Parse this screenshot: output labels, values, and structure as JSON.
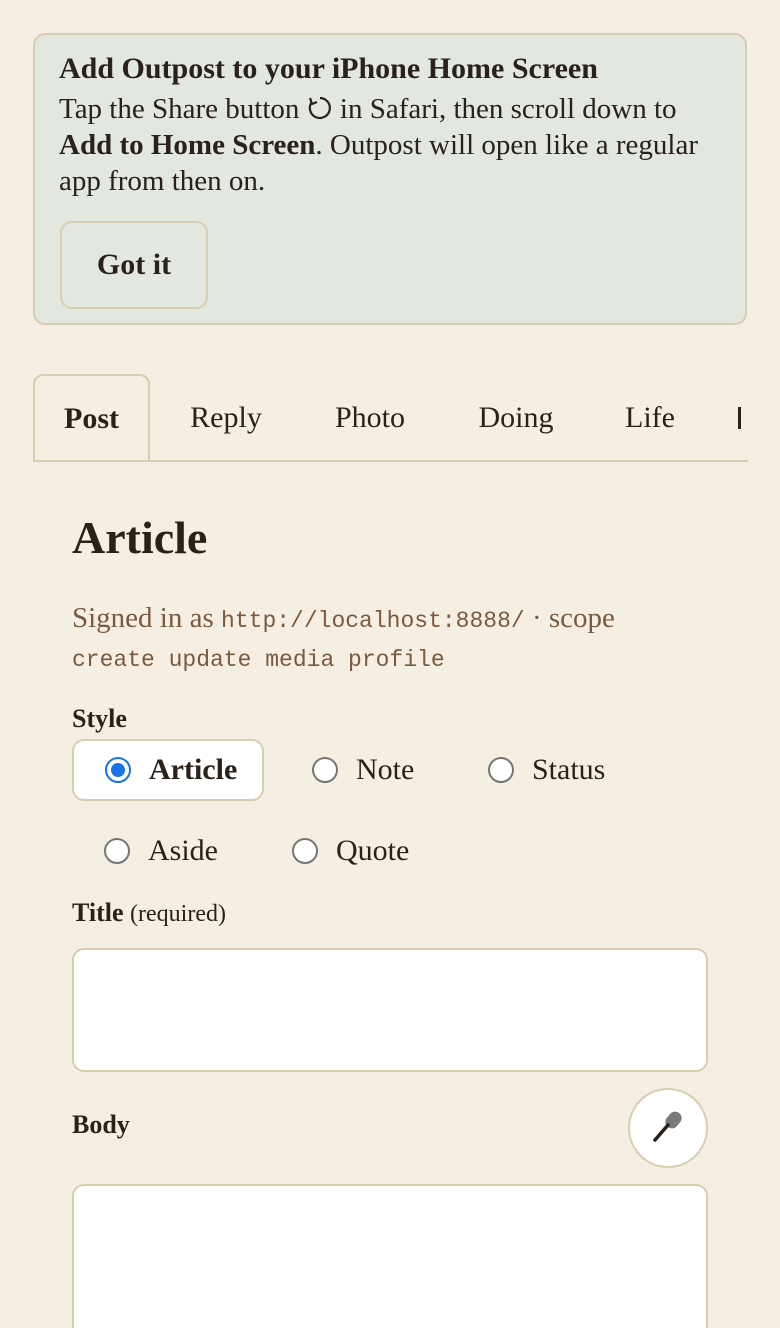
{
  "banner": {
    "title": "Add Outpost to your iPhone Home Screen",
    "text_before": "Tap the Share button ",
    "text_middle": " in Safari, then scroll down to ",
    "text_bold": "Add to Home Screen",
    "text_after": ". Outpost will open like a regular app from then on.",
    "dismiss_label": "Got it"
  },
  "tabs": [
    {
      "label": "Post",
      "active": true
    },
    {
      "label": "Reply"
    },
    {
      "label": "Photo"
    },
    {
      "label": "Doing"
    },
    {
      "label": "Life"
    }
  ],
  "form": {
    "heading": "Article",
    "signed_prefix": "Signed in as ",
    "signed_url": "http://localhost:8888/",
    "signed_scope_label": " · scope ",
    "signed_scopes": "create update media profile",
    "style_label": "Style",
    "styles": [
      {
        "label": "Article",
        "selected": true
      },
      {
        "label": "Note"
      },
      {
        "label": "Status"
      },
      {
        "label": "Aside"
      },
      {
        "label": "Quote"
      }
    ],
    "title_label": "Title",
    "title_note": "(required)",
    "title_value": "",
    "body_label": "Body",
    "body_value": ""
  },
  "icons": {
    "share": "share-icon",
    "mic": "microphone-icon"
  },
  "colors": {
    "background": "#f5efe3",
    "banner": "#e2e8e0",
    "border": "#d8ccb1",
    "muted_text": "#7a5a3e",
    "radio_accent": "#1a73e8"
  }
}
